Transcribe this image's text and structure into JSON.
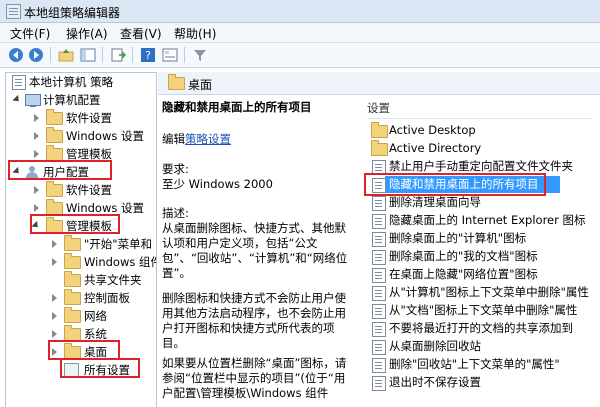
{
  "window": {
    "title": "本地组策略编辑器"
  },
  "menu": [
    "文件(F)",
    "操作(A)",
    "查看(V)",
    "帮助(H)"
  ],
  "toolbar": {
    "buttons": [
      "back-icon",
      "forward-icon",
      "up-folder-icon",
      "show-hide-tree-icon",
      "export-list-icon",
      "help-icon",
      "properties-icon",
      "filter-icon"
    ]
  },
  "tree": {
    "items": [
      {
        "label": "本地计算机 策略",
        "icon": "policy-icon",
        "expanded": true
      },
      {
        "label": "计算机配置",
        "icon": "computer-icon",
        "expanded": true
      },
      {
        "label": "软件设置",
        "icon": "folder-icon",
        "expanded": false
      },
      {
        "label": "Windows 设置",
        "icon": "folder-icon",
        "expanded": false
      },
      {
        "label": "管理模板",
        "icon": "folder-icon",
        "expanded": false
      },
      {
        "label": "用户配置",
        "icon": "user-icon",
        "expanded": true
      },
      {
        "label": "软件设置",
        "icon": "folder-icon",
        "expanded": false
      },
      {
        "label": "Windows 设置",
        "icon": "folder-icon",
        "expanded": false
      },
      {
        "label": "管理模板",
        "icon": "folder-icon",
        "expanded": true
      },
      {
        "label": "\"开始\"菜单和",
        "icon": "folder-icon",
        "expanded": false
      },
      {
        "label": "Windows 组件",
        "icon": "folder-icon",
        "expanded": false
      },
      {
        "label": "共享文件夹",
        "icon": "folder-icon",
        "expanded": false
      },
      {
        "label": "控制面板",
        "icon": "folder-icon",
        "expanded": false
      },
      {
        "label": "网络",
        "icon": "folder-icon",
        "expanded": false
      },
      {
        "label": "系统",
        "icon": "folder-icon",
        "expanded": false
      },
      {
        "label": "桌面",
        "icon": "folder-icon",
        "expanded": false
      },
      {
        "label": "所有设置",
        "icon": "all-settings-icon",
        "expanded": false
      }
    ]
  },
  "content": {
    "header": "桌面",
    "description": {
      "title": "隐藏和禁用桌面上的所有项目",
      "edit_prefix": "编辑",
      "edit_link": "策略设置",
      "requirements_label": "要求:",
      "requirements_value": "至少 Windows 2000",
      "description_label": "描述:",
      "description_text": "从桌面删除图标、快捷方式、其他默认项和用户定义项，包括“公文包”、“回收站”、“计算机”和“网络位置”。",
      "paragraph2": "删除图标和快捷方式不会防止用户使用其他方法启动程序，也不会防止用户打开图标和快捷方式所代表的项目。",
      "paragraph3": "如果要从位置栏删除“桌面”图标，请参阅“位置栏中显示的项目”(位于“用户配置\\管理模板\\Windows 组件"
    },
    "list": {
      "header": "设置",
      "items": [
        {
          "label": "Active Desktop",
          "icon": "folder-icon"
        },
        {
          "label": "Active Directory",
          "icon": "folder-icon"
        },
        {
          "label": "禁止用户手动重定向配置文件文件夹",
          "icon": "policy-icon"
        },
        {
          "label": "隐藏和禁用桌面上的所有项目",
          "icon": "policy-icon",
          "selected": true
        },
        {
          "label": "删除清理桌面向导",
          "icon": "policy-icon"
        },
        {
          "label": "隐藏桌面上的 Internet Explorer 图标",
          "icon": "policy-icon"
        },
        {
          "label": "删除桌面上的\"计算机\"图标",
          "icon": "policy-icon"
        },
        {
          "label": "删除桌面上的\"我的文档\"图标",
          "icon": "policy-icon"
        },
        {
          "label": "在桌面上隐藏\"网络位置\"图标",
          "icon": "policy-icon"
        },
        {
          "label": "从\"计算机\"图标上下文菜单中删除\"属性",
          "icon": "policy-icon"
        },
        {
          "label": "从\"文档\"图标上下文菜单中删除\"属性",
          "icon": "policy-icon"
        },
        {
          "label": "不要将最近打开的文档的共享添加到",
          "icon": "policy-icon"
        },
        {
          "label": "从桌面删除回收站",
          "icon": "policy-icon"
        },
        {
          "label": "删除\"回收站\"上下文菜单的\"属性\"",
          "icon": "policy-icon"
        },
        {
          "label": "退出时不保存设置",
          "icon": "policy-icon"
        }
      ]
    }
  },
  "colors": {
    "highlight_box": "#e0202a",
    "selection": "#3399ff"
  }
}
